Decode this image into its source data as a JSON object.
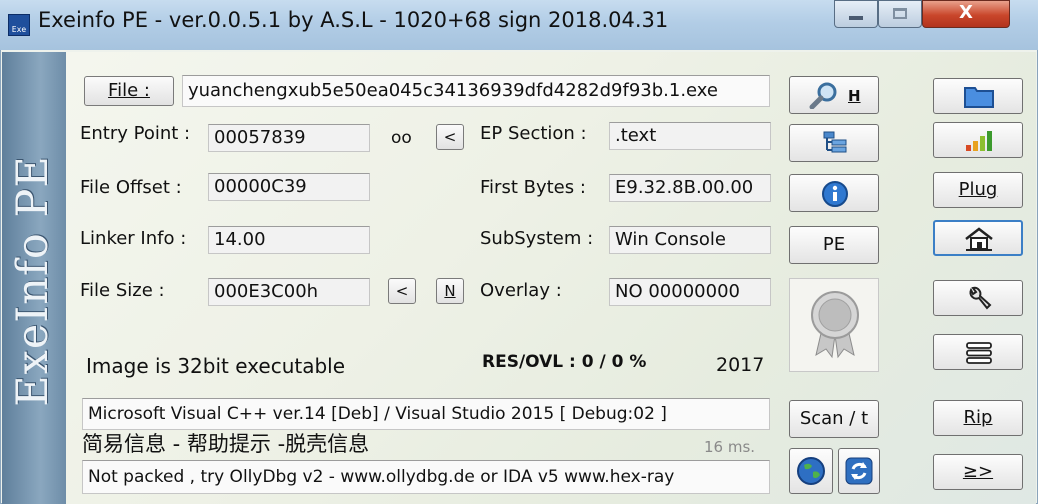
{
  "window": {
    "title": "Exeinfo PE - ver.0.0.5.1  by A.S.L -  1020+68 sign  2018.04.31",
    "app_badge": "Exe",
    "minimize_glyph": "",
    "maximize_glyph": "",
    "close_glyph": "X"
  },
  "sidebar": {
    "brand": "ExeInfo PE"
  },
  "file": {
    "button_label": "File :",
    "filename": "yuanchengxub5e50ea045c34136939dfd4282d9f93b.1.exe"
  },
  "fields": {
    "entry_point_label": "Entry Point :",
    "entry_point_value": "00057839",
    "oo_label": "oo",
    "prev_label": "<",
    "ep_section_label": "EP Section :",
    "ep_section_value": ".text",
    "file_offset_label": "File Offset :",
    "file_offset_value": "00000C39",
    "first_bytes_label": "First Bytes :",
    "first_bytes_value": "E9.32.8B.00.00",
    "linker_info_label": "Linker Info :",
    "linker_info_value": "14.00",
    "subsystem_label": "SubSystem :",
    "subsystem_value": "Win Console",
    "file_size_label": "File Size :",
    "file_size_value": "000E3C00h",
    "size_prev_label": "<",
    "size_n_label": "N",
    "overlay_label": "Overlay :",
    "overlay_value": "NO   00000000"
  },
  "info": {
    "image_type": "Image is 32bit executable",
    "res_ovl": "RES/OVL : 0 / 0 %",
    "year": "2017",
    "compiler": "Microsoft Visual C++ ver.14 [Deb] / Visual Studio 2015 [ Debug:02 ]",
    "chinese_caption": "简易信息 - 帮助提示 -脱壳信息",
    "timing": "16 ms.",
    "hint": "Not packed , try OllyDbg v2 - www.ollydbg.de or IDA v5 www.hex-ray"
  },
  "middle_buttons": {
    "search_h_label": "H",
    "pe_label": "PE",
    "scan_label": "Scan / t"
  },
  "right_buttons": {
    "plug_label": "Plug",
    "rip_label": "Rip",
    "next_label": "≥>"
  },
  "colors": {
    "accent": "#3b7fc6",
    "title_bar": "#b2cde6",
    "sidebar": "#7796b0"
  }
}
